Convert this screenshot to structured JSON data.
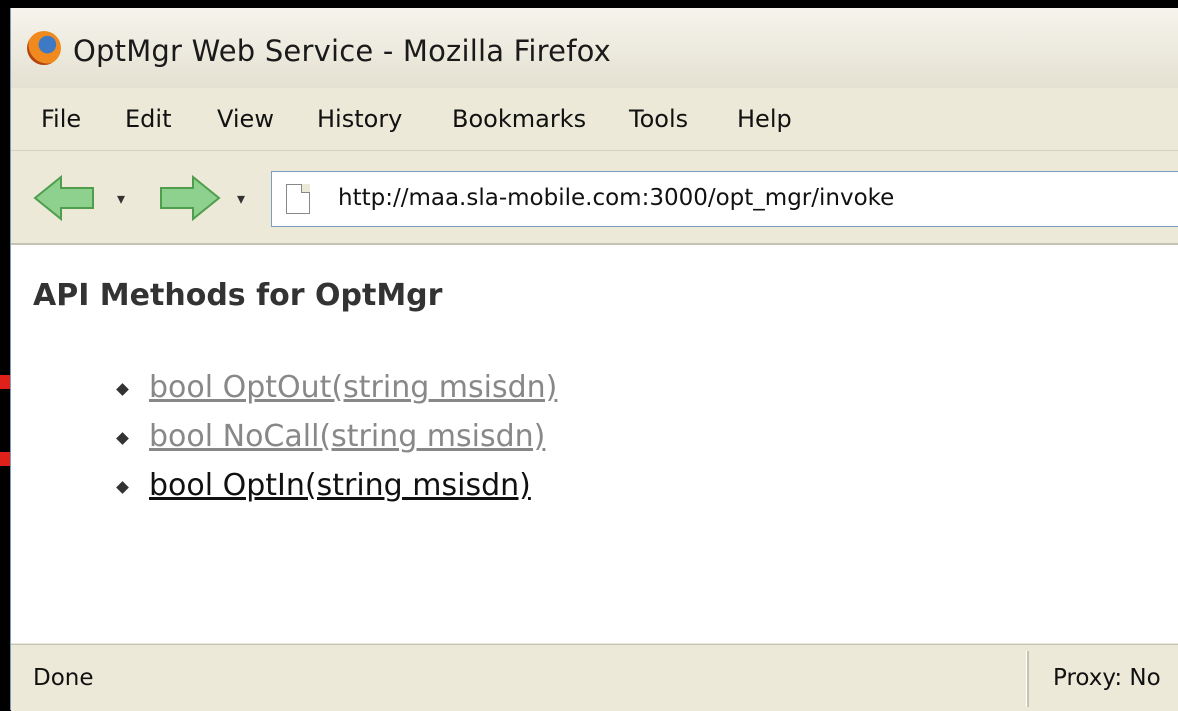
{
  "window": {
    "title": "OptMgr Web Service - Mozilla Firefox"
  },
  "menu": {
    "items": [
      {
        "label": "File"
      },
      {
        "label": "Edit"
      },
      {
        "label": "View"
      },
      {
        "label": "History"
      },
      {
        "label": "Bookmarks"
      },
      {
        "label": "Tools"
      },
      {
        "label": "Help"
      }
    ]
  },
  "nav": {
    "url": "http://maa.sla-mobile.com:3000/opt_mgr/invoke"
  },
  "page": {
    "heading": "API Methods for OptMgr",
    "methods": [
      {
        "label": "bool OptOut(string msisdn)",
        "state": "visited"
      },
      {
        "label": "bool NoCall(string msisdn)",
        "state": "visited"
      },
      {
        "label": "bool OptIn(string msisdn)",
        "state": "unvisited"
      }
    ]
  },
  "status": {
    "text": "Done",
    "proxy": "Proxy: No"
  },
  "colors": {
    "visited_link": "#888888",
    "link": "#111111",
    "chrome": "#ece9d8",
    "nav_arrow": "#6ec06e"
  },
  "icons": {
    "app": "firefox-icon",
    "back": "back-arrow-icon",
    "forward": "forward-arrow-icon",
    "page": "page-icon",
    "bullet": "bullet-icon"
  }
}
